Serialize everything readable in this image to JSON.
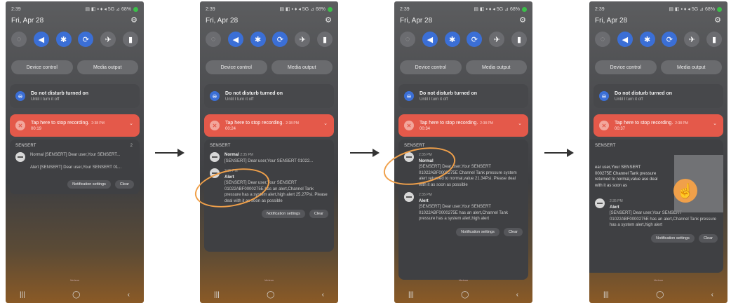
{
  "status": {
    "time": "2:39",
    "right_icons": "▤ ◧ ▪ ♦ ◂ 5G ⊿ 68%"
  },
  "date": "Fri, Apr 28",
  "quick_settings": [
    {
      "name": "wifi-icon",
      "glyph": "◌"
    },
    {
      "name": "mute-icon",
      "glyph": "◀"
    },
    {
      "name": "bluetooth-icon",
      "glyph": "✱"
    },
    {
      "name": "sync-icon",
      "glyph": "⟳"
    },
    {
      "name": "airplane-icon",
      "glyph": "✈"
    },
    {
      "name": "flashlight-icon",
      "glyph": "▮"
    }
  ],
  "pills": {
    "device_control": "Device control",
    "media_output": "Media output"
  },
  "dnd": {
    "title": "Do not disturb turned on",
    "subtitle": "Until I turn it off"
  },
  "recording": [
    {
      "title": "Tap here to stop recording.",
      "time": "2:38 PM",
      "elapsed": "00:19"
    },
    {
      "title": "Tap here to stop recording.",
      "time": "2:38 PM",
      "elapsed": "00:24"
    },
    {
      "title": "Tap here to stop recording.",
      "time": "2:38 PM",
      "elapsed": "00:34"
    },
    {
      "title": "Tap here to stop recording.",
      "time": "2:38 PM",
      "elapsed": "00:37"
    }
  ],
  "group": {
    "app": "SENSERT",
    "count": "2"
  },
  "panel1": {
    "normal": "Normal [SENSERT] Dear user,Your SENSERT...",
    "alert": "Alert [SENSERT] Dear user,Your SENSERT 01..."
  },
  "panel2": {
    "normal_title": "Normal",
    "normal_time": "2:35 PM",
    "normal_text": "[SENSERT] Dear user,Your SENSERT 01022...",
    "alert_time": "2:35 PM",
    "alert_title": "Alert",
    "alert_text": "[SENSERT] Dear user,Your SENSERT 01022ABF0000275E has an alert,Channel Tank pressure has a system alert,high alert 25.27Psi. Please deal with it as soon as possible"
  },
  "panel3": {
    "normal_time": "2:35 PM",
    "normal_title": "Normal",
    "normal_text": "[SENSERT] Dear user,Your SENSERT 01022ABF0000275E Channel Tank pressure system alert returned to normal,value 21.34Psi. Please deal with it as soon as possible",
    "alert_time": "2:35 PM",
    "alert_title": "Alert",
    "alert_text": "[SENSERT] Dear user,Your SENSERT 01022ABF0000275E has an alert,Channel Tank pressure has a system alert,high alert"
  },
  "panel4": {
    "swiped_text": "ear user,Your SENSERT 000275E Channel Tank pressure returned to normal,value ase deal with it as soon as",
    "alert_time": "2:35 PM",
    "alert_title": "Alert",
    "alert_text": "[SENSERT] Dear user,Your SENSERT 01022ABF0000275E has an alert,Channel Tank pressure has a system alert,high alert"
  },
  "actions": {
    "settings": "Notification settings",
    "clear": "Clear"
  },
  "nav": {
    "recent": "|||",
    "home": "◯",
    "back": "‹"
  },
  "bottom_caption": "Verizon"
}
